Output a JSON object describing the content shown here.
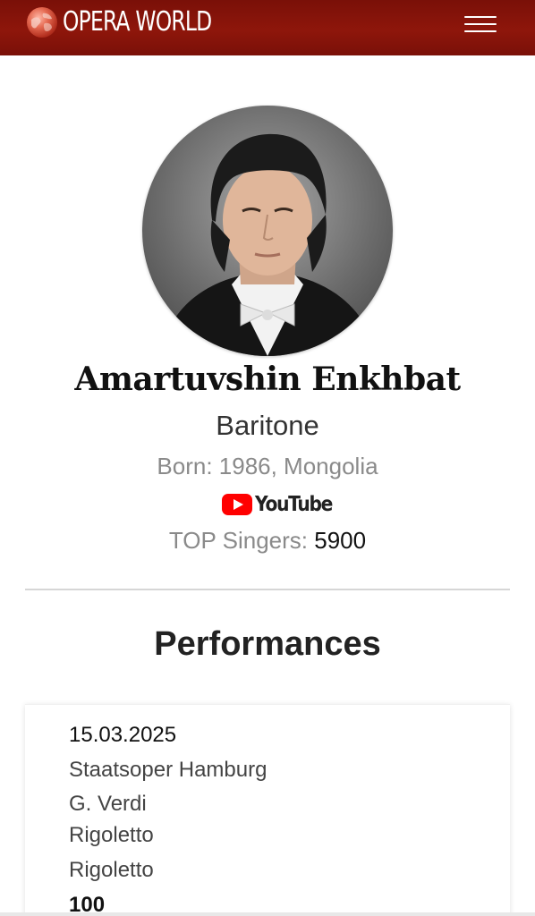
{
  "header": {
    "logo_text": "OPERA WORLD",
    "logo_icon": "globe-icon",
    "menu_icon": "hamburger-menu-icon",
    "background_color": "#8e160b"
  },
  "profile": {
    "name": "Amartuvshin Enkhbat",
    "voice_type": "Baritone",
    "born": "Born: 1986, Mongolia",
    "youtube": {
      "icon": "youtube-play-icon",
      "label": "YouTube",
      "brand_color": "#ff0000"
    },
    "top_label": "TOP Singers:",
    "top_value": "5900"
  },
  "performances": {
    "title": "Performances",
    "items": [
      {
        "date": "15.03.2025",
        "venue": "Staatsoper Hamburg",
        "composer": "G. Verdi",
        "opera": "Rigoletto",
        "role": "Rigoletto",
        "extra": "100"
      }
    ]
  }
}
